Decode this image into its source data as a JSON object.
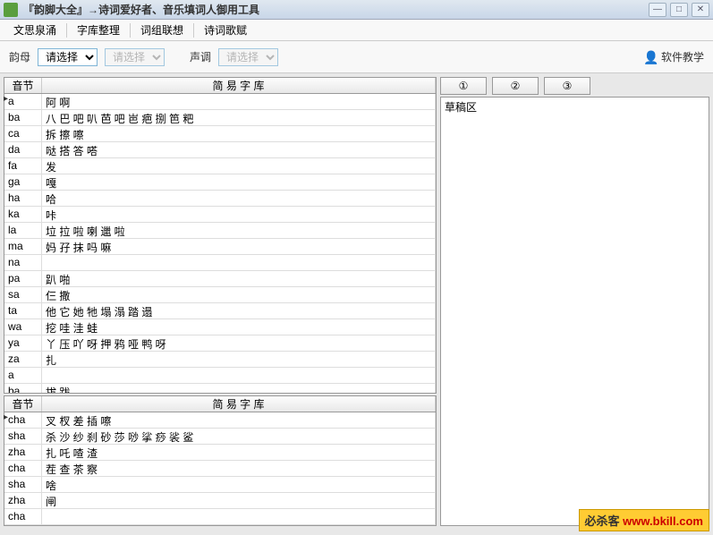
{
  "window": {
    "title": "『韵脚大全』→诗词爱好者、音乐填词人御用工具"
  },
  "menu": {
    "items": [
      "文思泉涌",
      "字库整理",
      "词组联想",
      "诗词歌赋"
    ]
  },
  "toolbar": {
    "rhyme_label": "韵母",
    "rhyme_value": "请选择",
    "rhyme_placeholder": "请选择",
    "tone_label": "声调",
    "tone_value": "请选择",
    "help_label": "软件教学"
  },
  "table1": {
    "headers": [
      "音节",
      "简 易 字 库"
    ],
    "rows": [
      {
        "syl": "a",
        "chars": "阿 啊",
        "mark": true
      },
      {
        "syl": "ba",
        "chars": "八 巴 吧 叭 芭 吧 岜 疤 捌 笆 粑"
      },
      {
        "syl": "ca",
        "chars": "拆 擦 嚓"
      },
      {
        "syl": "da",
        "chars": "哒 搭 答 嗒"
      },
      {
        "syl": "fa",
        "chars": "发"
      },
      {
        "syl": "ga",
        "chars": "嘎"
      },
      {
        "syl": "ha",
        "chars": "哈"
      },
      {
        "syl": "ka",
        "chars": "咔"
      },
      {
        "syl": "la",
        "chars": "垃 拉 啦 喇 邋 啦"
      },
      {
        "syl": "ma",
        "chars": "妈 孖 抹 吗 嘛"
      },
      {
        "syl": "na",
        "chars": ""
      },
      {
        "syl": "pa",
        "chars": "趴 啪"
      },
      {
        "syl": "sa",
        "chars": "仨 撒"
      },
      {
        "syl": "ta",
        "chars": "他 它 她 牠 塌 溻 踏 遢"
      },
      {
        "syl": "wa",
        "chars": "挖 哇 洼 蛙"
      },
      {
        "syl": "ya",
        "chars": "丫 压 吖 呀 押 鸦 哑 鸭 呀"
      },
      {
        "syl": "za",
        "chars": "扎"
      },
      {
        "syl": "a",
        "chars": ""
      },
      {
        "syl": "ba",
        "chars": "拔 跋"
      }
    ]
  },
  "table2": {
    "headers": [
      "音节",
      "简 易 字 库"
    ],
    "rows": [
      {
        "syl": "cha",
        "chars": "叉 杈 差 插 嚓",
        "mark": true
      },
      {
        "syl": "sha",
        "chars": "杀 沙 纱 刹 砂 莎 唦 挲 痧 裟 鲨"
      },
      {
        "syl": "zha",
        "chars": "扎 吒 喳 渣"
      },
      {
        "syl": "cha",
        "chars": "茬 查 茶 察"
      },
      {
        "syl": "sha",
        "chars": "啥"
      },
      {
        "syl": "zha",
        "chars": "闸"
      },
      {
        "syl": "cha",
        "chars": ""
      }
    ]
  },
  "right": {
    "tabs": [
      "①",
      "②",
      "③"
    ],
    "draft_label": "草稿区"
  },
  "watermark": {
    "text": "必杀客",
    "url": "www.bkill.com"
  }
}
